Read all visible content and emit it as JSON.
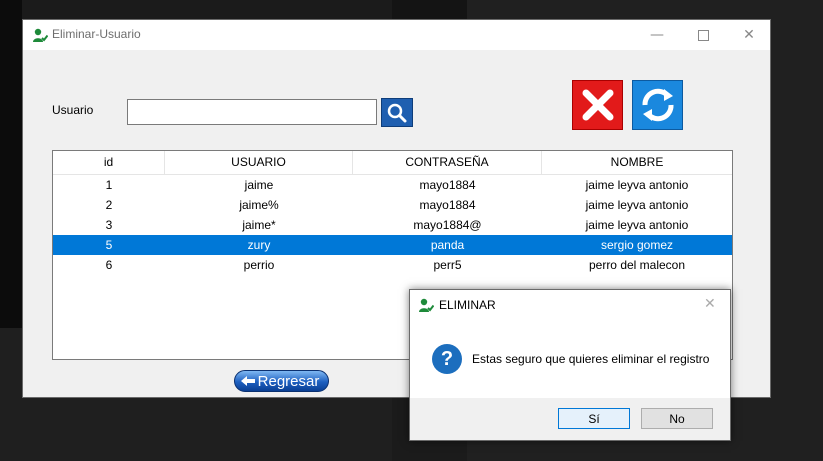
{
  "window": {
    "title": "Eliminar-Usuario",
    "minimize_glyph": "—",
    "close_glyph": "✕"
  },
  "form": {
    "usuario_label": "Usuario",
    "search_value": "",
    "search_placeholder": ""
  },
  "icons": {
    "app": "user-icon",
    "search": "magnifier-icon",
    "delete": "red-x-icon",
    "refresh": "refresh-arrows-icon",
    "back": "back-arrow-icon",
    "question": "question-icon"
  },
  "table": {
    "columns": [
      "id",
      "USUARIO",
      "CONTRASEÑA",
      "NOMBRE"
    ],
    "rows": [
      [
        "1",
        "jaime",
        "mayo1884",
        "jaime leyva antonio"
      ],
      [
        "2",
        "jaime%",
        "mayo1884",
        "jaime leyva antonio"
      ],
      [
        "3",
        "jaime*",
        "mayo1884@",
        "jaime leyva antonio"
      ],
      [
        "5",
        "zury",
        "panda",
        "sergio gomez"
      ],
      [
        "6",
        "perrio",
        "perr5",
        "perro del malecon"
      ]
    ],
    "selected_row_index": 3
  },
  "back_button_label": "Regresar",
  "dialog": {
    "title": "ELIMINAR",
    "close_glyph": "✕",
    "question_glyph": "?",
    "message": "Estas seguro que quieres eliminar el registro",
    "yes_label": "Sí",
    "no_label": "No"
  },
  "colors": {
    "selection": "#0078d7",
    "delete": "#e21a1a",
    "refresh": "#1a88de",
    "search": "#1f5fb0"
  }
}
